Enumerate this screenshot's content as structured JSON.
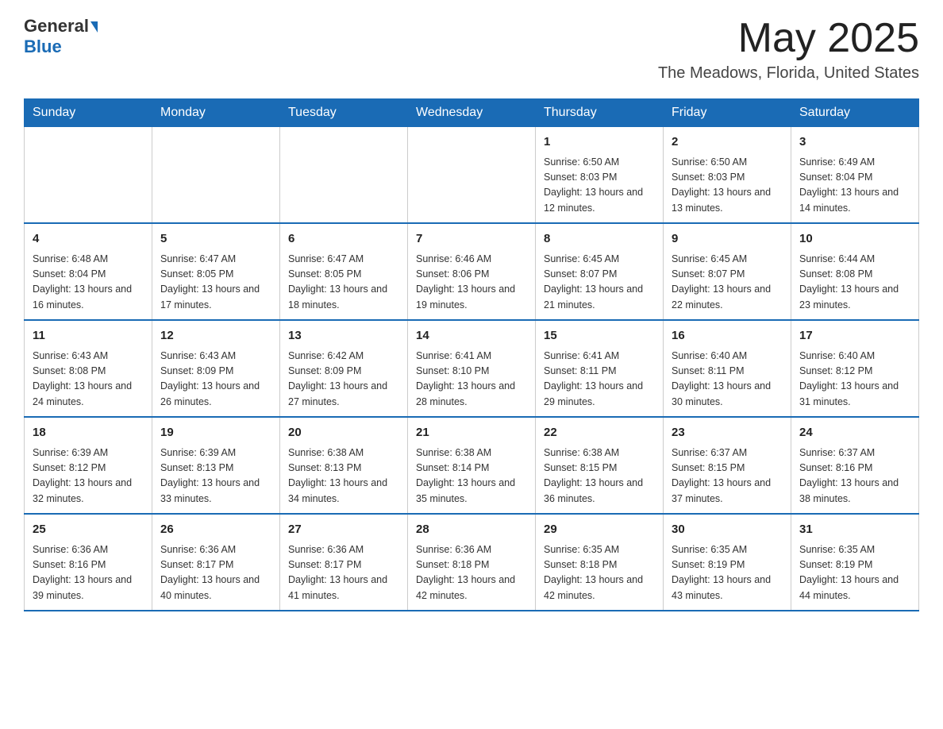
{
  "header": {
    "logo": {
      "general": "General",
      "blue": "Blue"
    },
    "title": "May 2025",
    "location": "The Meadows, Florida, United States"
  },
  "calendar": {
    "days_of_week": [
      "Sunday",
      "Monday",
      "Tuesday",
      "Wednesday",
      "Thursday",
      "Friday",
      "Saturday"
    ],
    "weeks": [
      [
        {
          "day": "",
          "info": ""
        },
        {
          "day": "",
          "info": ""
        },
        {
          "day": "",
          "info": ""
        },
        {
          "day": "",
          "info": ""
        },
        {
          "day": "1",
          "info": "Sunrise: 6:50 AM\nSunset: 8:03 PM\nDaylight: 13 hours and 12 minutes."
        },
        {
          "day": "2",
          "info": "Sunrise: 6:50 AM\nSunset: 8:03 PM\nDaylight: 13 hours and 13 minutes."
        },
        {
          "day": "3",
          "info": "Sunrise: 6:49 AM\nSunset: 8:04 PM\nDaylight: 13 hours and 14 minutes."
        }
      ],
      [
        {
          "day": "4",
          "info": "Sunrise: 6:48 AM\nSunset: 8:04 PM\nDaylight: 13 hours and 16 minutes."
        },
        {
          "day": "5",
          "info": "Sunrise: 6:47 AM\nSunset: 8:05 PM\nDaylight: 13 hours and 17 minutes."
        },
        {
          "day": "6",
          "info": "Sunrise: 6:47 AM\nSunset: 8:05 PM\nDaylight: 13 hours and 18 minutes."
        },
        {
          "day": "7",
          "info": "Sunrise: 6:46 AM\nSunset: 8:06 PM\nDaylight: 13 hours and 19 minutes."
        },
        {
          "day": "8",
          "info": "Sunrise: 6:45 AM\nSunset: 8:07 PM\nDaylight: 13 hours and 21 minutes."
        },
        {
          "day": "9",
          "info": "Sunrise: 6:45 AM\nSunset: 8:07 PM\nDaylight: 13 hours and 22 minutes."
        },
        {
          "day": "10",
          "info": "Sunrise: 6:44 AM\nSunset: 8:08 PM\nDaylight: 13 hours and 23 minutes."
        }
      ],
      [
        {
          "day": "11",
          "info": "Sunrise: 6:43 AM\nSunset: 8:08 PM\nDaylight: 13 hours and 24 minutes."
        },
        {
          "day": "12",
          "info": "Sunrise: 6:43 AM\nSunset: 8:09 PM\nDaylight: 13 hours and 26 minutes."
        },
        {
          "day": "13",
          "info": "Sunrise: 6:42 AM\nSunset: 8:09 PM\nDaylight: 13 hours and 27 minutes."
        },
        {
          "day": "14",
          "info": "Sunrise: 6:41 AM\nSunset: 8:10 PM\nDaylight: 13 hours and 28 minutes."
        },
        {
          "day": "15",
          "info": "Sunrise: 6:41 AM\nSunset: 8:11 PM\nDaylight: 13 hours and 29 minutes."
        },
        {
          "day": "16",
          "info": "Sunrise: 6:40 AM\nSunset: 8:11 PM\nDaylight: 13 hours and 30 minutes."
        },
        {
          "day": "17",
          "info": "Sunrise: 6:40 AM\nSunset: 8:12 PM\nDaylight: 13 hours and 31 minutes."
        }
      ],
      [
        {
          "day": "18",
          "info": "Sunrise: 6:39 AM\nSunset: 8:12 PM\nDaylight: 13 hours and 32 minutes."
        },
        {
          "day": "19",
          "info": "Sunrise: 6:39 AM\nSunset: 8:13 PM\nDaylight: 13 hours and 33 minutes."
        },
        {
          "day": "20",
          "info": "Sunrise: 6:38 AM\nSunset: 8:13 PM\nDaylight: 13 hours and 34 minutes."
        },
        {
          "day": "21",
          "info": "Sunrise: 6:38 AM\nSunset: 8:14 PM\nDaylight: 13 hours and 35 minutes."
        },
        {
          "day": "22",
          "info": "Sunrise: 6:38 AM\nSunset: 8:15 PM\nDaylight: 13 hours and 36 minutes."
        },
        {
          "day": "23",
          "info": "Sunrise: 6:37 AM\nSunset: 8:15 PM\nDaylight: 13 hours and 37 minutes."
        },
        {
          "day": "24",
          "info": "Sunrise: 6:37 AM\nSunset: 8:16 PM\nDaylight: 13 hours and 38 minutes."
        }
      ],
      [
        {
          "day": "25",
          "info": "Sunrise: 6:36 AM\nSunset: 8:16 PM\nDaylight: 13 hours and 39 minutes."
        },
        {
          "day": "26",
          "info": "Sunrise: 6:36 AM\nSunset: 8:17 PM\nDaylight: 13 hours and 40 minutes."
        },
        {
          "day": "27",
          "info": "Sunrise: 6:36 AM\nSunset: 8:17 PM\nDaylight: 13 hours and 41 minutes."
        },
        {
          "day": "28",
          "info": "Sunrise: 6:36 AM\nSunset: 8:18 PM\nDaylight: 13 hours and 42 minutes."
        },
        {
          "day": "29",
          "info": "Sunrise: 6:35 AM\nSunset: 8:18 PM\nDaylight: 13 hours and 42 minutes."
        },
        {
          "day": "30",
          "info": "Sunrise: 6:35 AM\nSunset: 8:19 PM\nDaylight: 13 hours and 43 minutes."
        },
        {
          "day": "31",
          "info": "Sunrise: 6:35 AM\nSunset: 8:19 PM\nDaylight: 13 hours and 44 minutes."
        }
      ]
    ]
  }
}
